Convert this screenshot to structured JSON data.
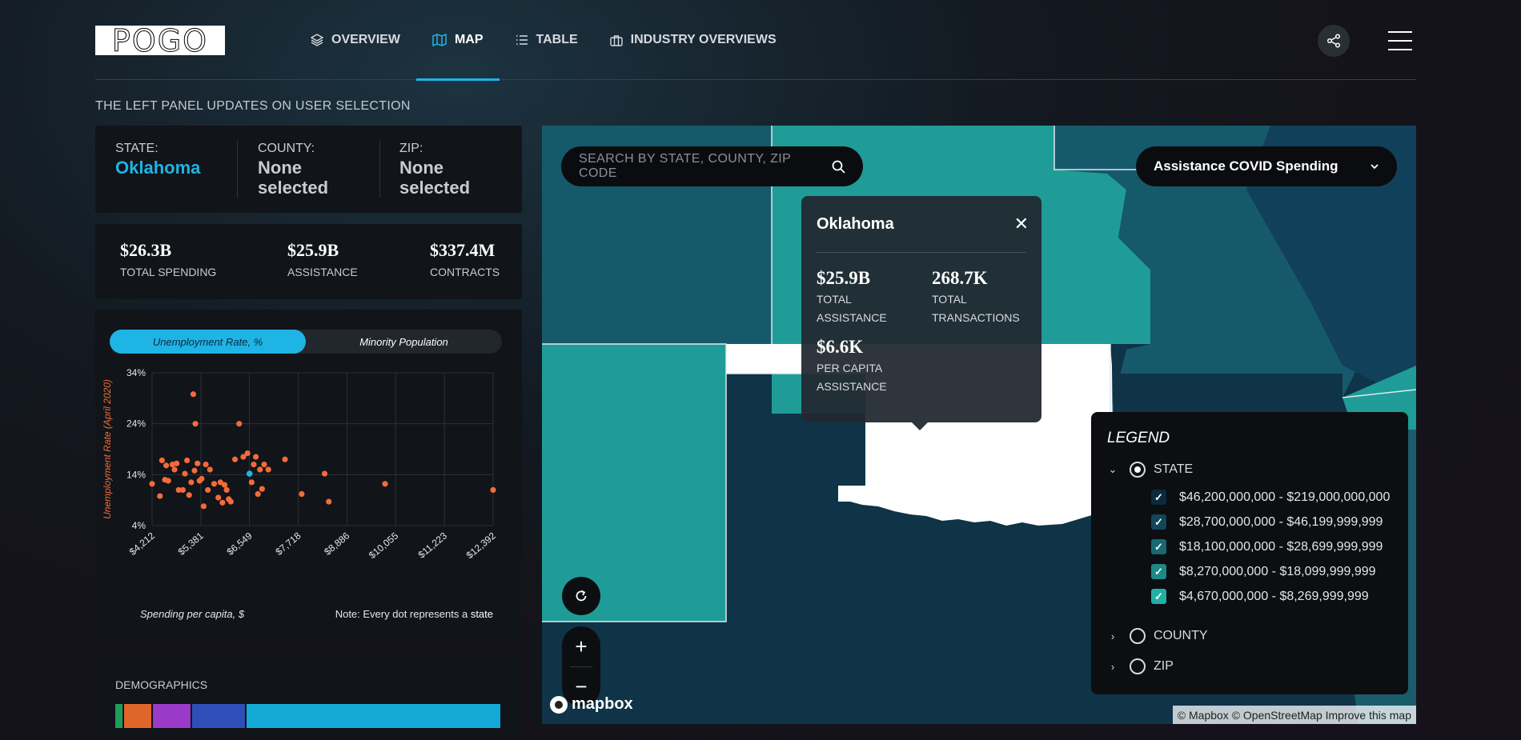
{
  "header": {
    "logo": "POGO",
    "nav": [
      {
        "label": "OVERVIEW",
        "icon": "layers-icon"
      },
      {
        "label": "MAP",
        "icon": "map-icon"
      },
      {
        "label": "TABLE",
        "icon": "list-icon"
      },
      {
        "label": "INDUSTRY OVERVIEWS",
        "icon": "briefcase-icon"
      }
    ],
    "active_tab": "MAP"
  },
  "subtitle": "THE LEFT PANEL UPDATES ON USER SELECTION",
  "selection": {
    "state_label": "STATE:",
    "state_value": "Oklahoma",
    "county_label": "COUNTY:",
    "county_value": "None selected",
    "zip_label": "ZIP:",
    "zip_value": "None selected"
  },
  "totals": [
    {
      "value": "$26.3B",
      "label": "TOTAL SPENDING"
    },
    {
      "value": "$25.9B",
      "label": "ASSISTANCE"
    },
    {
      "value": "$337.4M",
      "label": "CONTRACTS"
    }
  ],
  "scatter_panel": {
    "toggle_active": "Unemployment Rate, %",
    "toggle_inactive": "Minority Population",
    "xlabel": "Spending per capita, $",
    "note_prefix": "Note: Every dot represents a",
    "note_emph": "state"
  },
  "chart_data": {
    "type": "scatter",
    "title": "",
    "xlabel": "Spending per capita, $",
    "ylabel": "Unemployment Rate (April 2020)",
    "x_ticks": [
      "$4,212",
      "$5,381",
      "$6,549",
      "$7,718",
      "$8,886",
      "$10,055",
      "$11,223",
      "$12,392"
    ],
    "y_ticks": [
      "4%",
      "14%",
      "24%",
      "34%"
    ],
    "xlim": [
      4212,
      12392
    ],
    "ylim": [
      4,
      34
    ],
    "grid": true,
    "highlight_color": "#1fb4e6",
    "point_color": "#f26b3a",
    "points": [
      [
        4212,
        12.2
      ],
      [
        4400,
        9.8
      ],
      [
        4450,
        16.8
      ],
      [
        4520,
        13.0
      ],
      [
        4550,
        15.8
      ],
      [
        4600,
        12.8
      ],
      [
        4700,
        16.0
      ],
      [
        4750,
        15.0
      ],
      [
        4800,
        16.2
      ],
      [
        4850,
        11.0
      ],
      [
        4950,
        11.0
      ],
      [
        5000,
        14.2
      ],
      [
        5050,
        16.8
      ],
      [
        5100,
        10.0
      ],
      [
        5150,
        12.5
      ],
      [
        5200,
        29.8
      ],
      [
        5230,
        14.8
      ],
      [
        5250,
        24.0
      ],
      [
        5300,
        16.2
      ],
      [
        5350,
        12.8
      ],
      [
        5400,
        13.2
      ],
      [
        5450,
        7.8
      ],
      [
        5500,
        16.0
      ],
      [
        5550,
        11.0
      ],
      [
        5600,
        15.0
      ],
      [
        5700,
        12.2
      ],
      [
        5800,
        9.5
      ],
      [
        5850,
        12.5
      ],
      [
        5900,
        8.5
      ],
      [
        5950,
        12.0
      ],
      [
        6000,
        11.0
      ],
      [
        6050,
        9.2
      ],
      [
        6100,
        8.7
      ],
      [
        6200,
        17.0
      ],
      [
        6300,
        24.0
      ],
      [
        6400,
        17.5
      ],
      [
        6500,
        18.2
      ],
      [
        6600,
        12.5
      ],
      [
        6650,
        16.0
      ],
      [
        6700,
        17.5
      ],
      [
        6750,
        10.2
      ],
      [
        6800,
        15.0
      ],
      [
        6850,
        11.2
      ],
      [
        6900,
        16.0
      ],
      [
        7000,
        15.0
      ],
      [
        7400,
        17.0
      ],
      [
        7800,
        10.2
      ],
      [
        8350,
        14.2
      ],
      [
        8450,
        8.7
      ],
      [
        9800,
        12.2
      ],
      [
        12392,
        11.0
      ]
    ],
    "highlight_point": [
      6549,
      14.2
    ]
  },
  "demographics": {
    "title": "DEMOGRAPHICS",
    "segments": [
      {
        "color": "#1e9e5a",
        "weight": 2
      },
      {
        "color": "#e0652a",
        "weight": 7
      },
      {
        "color": "#9a3ac8",
        "weight": 10
      },
      {
        "color": "#2f4fb8",
        "weight": 14
      },
      {
        "color": "#12a9d6",
        "weight": 67
      }
    ]
  },
  "map": {
    "search_placeholder": "SEARCH BY STATE, COUNTY, ZIP CODE",
    "dropdown_value": "Assistance COVID Spending",
    "tooltip": {
      "title": "Oklahoma",
      "stats": [
        {
          "value": "$25.9B",
          "label": "TOTAL ASSISTANCE"
        },
        {
          "value": "268.7K",
          "label": "TOTAL TRANSACTIONS"
        },
        {
          "value": "$6.6K",
          "label": "PER CAPITA ASSISTANCE"
        }
      ]
    },
    "mapbox_label": "mapbox",
    "attribution": "© Mapbox © OpenStreetMap Improve this map",
    "colors": {
      "light": "#1f9c97",
      "mid": "#16596a",
      "dark": "#0f3347",
      "selected": "#ffffff"
    }
  },
  "legend": {
    "title": "LEGEND",
    "state_label": "STATE",
    "county_label": "COUNTY",
    "zip_label": "ZIP",
    "ranges": [
      {
        "label": "$46,200,000,000 - $219,000,000,000",
        "color": "#0b2b3c"
      },
      {
        "label": "$28,700,000,000 - $46,199,999,999",
        "color": "#12465a"
      },
      {
        "label": "$18,100,000,000 - $28,699,999,999",
        "color": "#176872"
      },
      {
        "label": "$8,270,000,000 - $18,099,999,999",
        "color": "#1b8a88"
      },
      {
        "label": "$4,670,000,000 - $8,269,999,999",
        "color": "#22b0a4"
      }
    ]
  }
}
